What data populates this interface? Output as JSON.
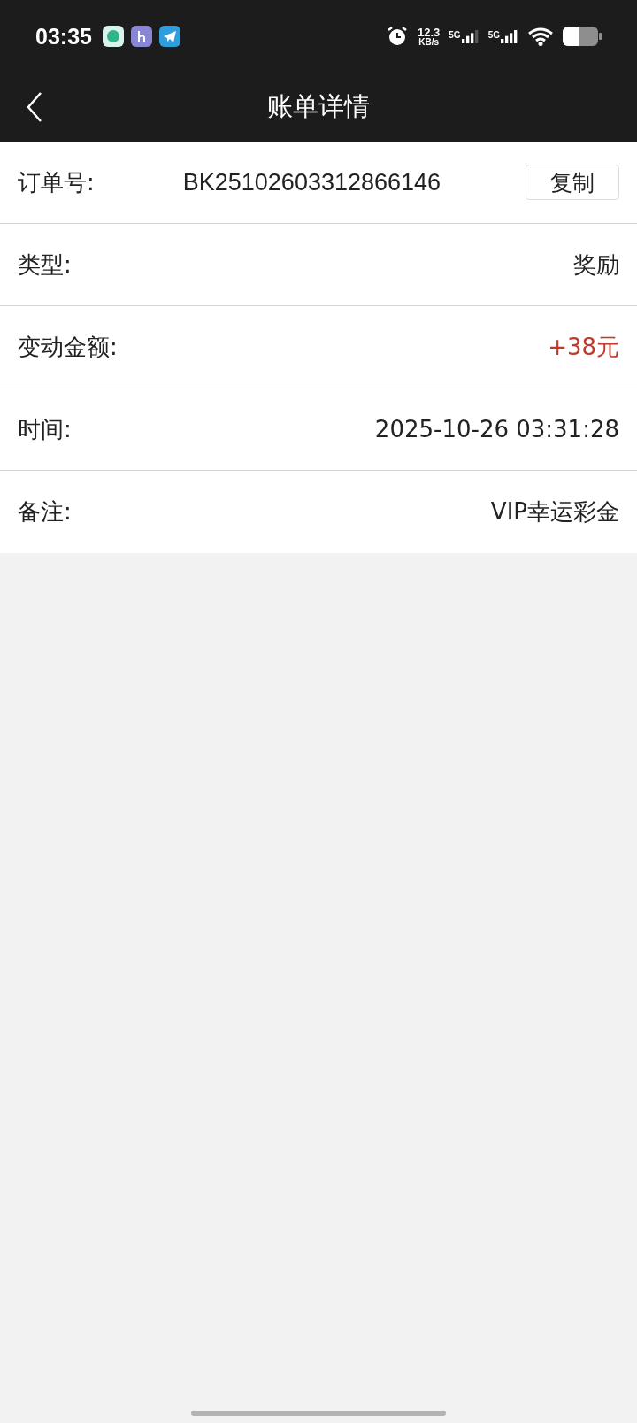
{
  "status_bar": {
    "time": "03:35",
    "net_speed": "12.3",
    "net_unit": "KB/s",
    "sim_1": "5G",
    "sim_2": "5G"
  },
  "nav": {
    "title": "账单详情"
  },
  "rows": [
    {
      "kind": "copy",
      "label": "订单号:",
      "value": "BK25102603312866146",
      "button": "复制"
    },
    {
      "kind": "plain",
      "label": "类型:",
      "value": "奖励"
    },
    {
      "kind": "amount",
      "label": "变动金额:",
      "value": "+38元"
    },
    {
      "kind": "plain",
      "label": "时间:",
      "value": "2025-10-26 03:31:28"
    },
    {
      "kind": "plain",
      "label": "备注:",
      "value": "VIP幸运彩金"
    }
  ]
}
